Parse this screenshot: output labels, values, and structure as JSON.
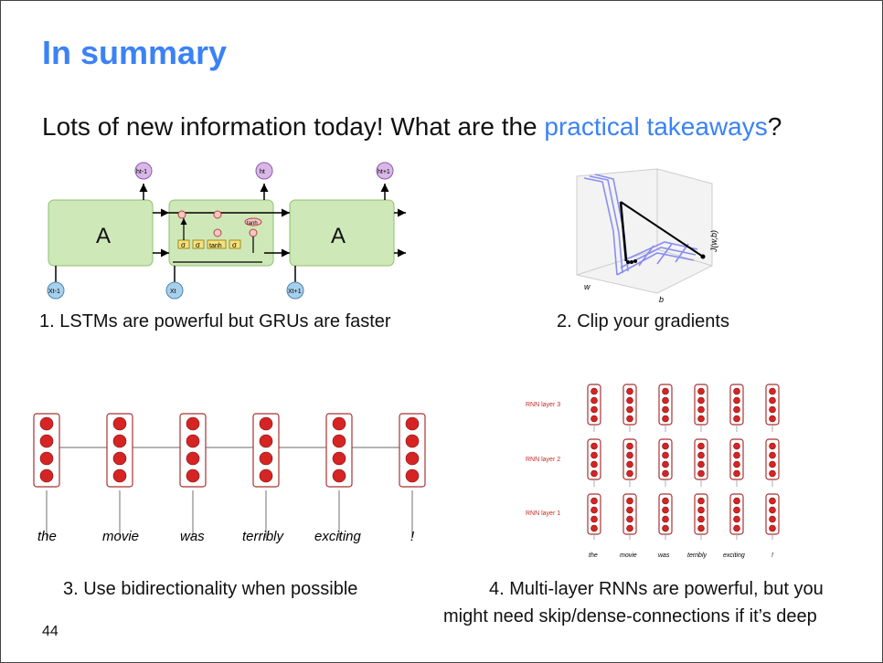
{
  "slide": {
    "title": "In summary",
    "subtitle_prefix": "Lots of new information today! What are the ",
    "subtitle_accent": "practical takeaways",
    "subtitle_suffix": "?",
    "page_number": "44"
  },
  "colors": {
    "accent": "#3b82f6",
    "cell_fill": "#cfe8b8",
    "neuron_red": "#d62424",
    "layer_label_red": "#c62828"
  },
  "takeaways": [
    {
      "caption": "1. LSTMs are powerful but GRUs are faster"
    },
    {
      "caption": "2. Clip your gradients"
    },
    {
      "caption": "3. Use bidirectionality when possible"
    },
    {
      "caption_line1": "4. Multi-layer RNNs are powerful, but you",
      "caption_line2": "might need skip/dense-connections if it’s deep"
    }
  ],
  "lstm_diagram": {
    "cell_label": "A",
    "outputs": [
      "ht-1",
      "ht",
      "ht+1"
    ],
    "inputs": [
      "Xt-1",
      "Xt",
      "Xt+1"
    ],
    "gates": [
      "σ",
      "σ",
      "tanh",
      "σ"
    ],
    "ops": [
      "×",
      "+",
      "×",
      "tanh",
      "×"
    ]
  },
  "gradient_plot": {
    "z_label": "J(w,b)",
    "x_label": "w",
    "y_label": "b"
  },
  "bidirectional": {
    "words": [
      "the",
      "movie",
      "was",
      "terribly",
      "exciting",
      "!"
    ]
  },
  "multilayer": {
    "layers": [
      "RNN layer 3",
      "RNN layer 2",
      "RNN layer 1"
    ],
    "words": [
      "the",
      "movie",
      "was",
      "terribly",
      "exciting",
      "!"
    ]
  }
}
